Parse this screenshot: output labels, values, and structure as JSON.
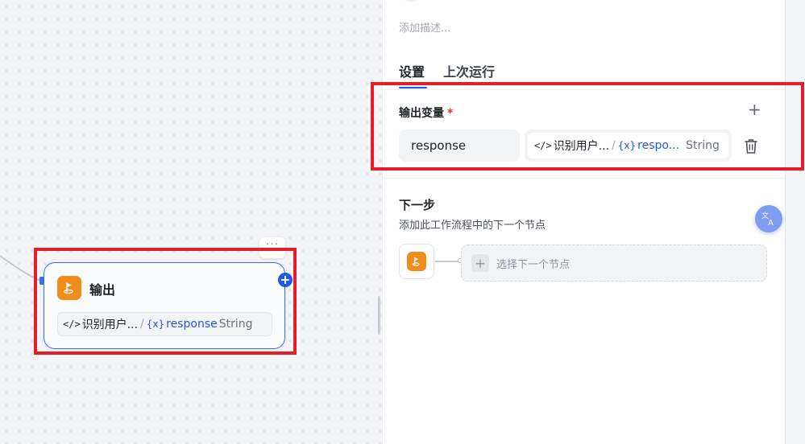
{
  "canvas": {
    "node": {
      "title": "输出",
      "more_label": "···",
      "add_label": "+",
      "variable": {
        "code_glyph": "</>",
        "source": "识别用户...",
        "separator": "/",
        "var_glyph": "{x}",
        "name": "response",
        "type": "String"
      }
    }
  },
  "panel": {
    "description_placeholder": "添加描述...",
    "tabs": [
      {
        "label": "设置",
        "active": true
      },
      {
        "label": "上次运行",
        "active": false
      }
    ],
    "output_section": {
      "title": "输出变量",
      "required_mark": "*",
      "add_label": "+",
      "rows": [
        {
          "name": "response",
          "code_glyph": "</>",
          "source": "识别用户...",
          "separator": "/",
          "var_glyph": "{x}",
          "variable": "respo...",
          "type": "String"
        }
      ]
    },
    "next_step": {
      "title": "下一步",
      "description": "添加此工作流程中的下一个节点",
      "select_label": "选择下一个节点",
      "plus": "+"
    }
  },
  "colors": {
    "accent": "#1f57f0",
    "node_icon": "#f08c1a",
    "highlight": "#e61e25",
    "required": "#e0362b"
  },
  "icons": [
    "flag-icon",
    "plus-icon",
    "trash-icon",
    "translate-icon",
    "code-icon",
    "variable-icon",
    "more-icon"
  ]
}
